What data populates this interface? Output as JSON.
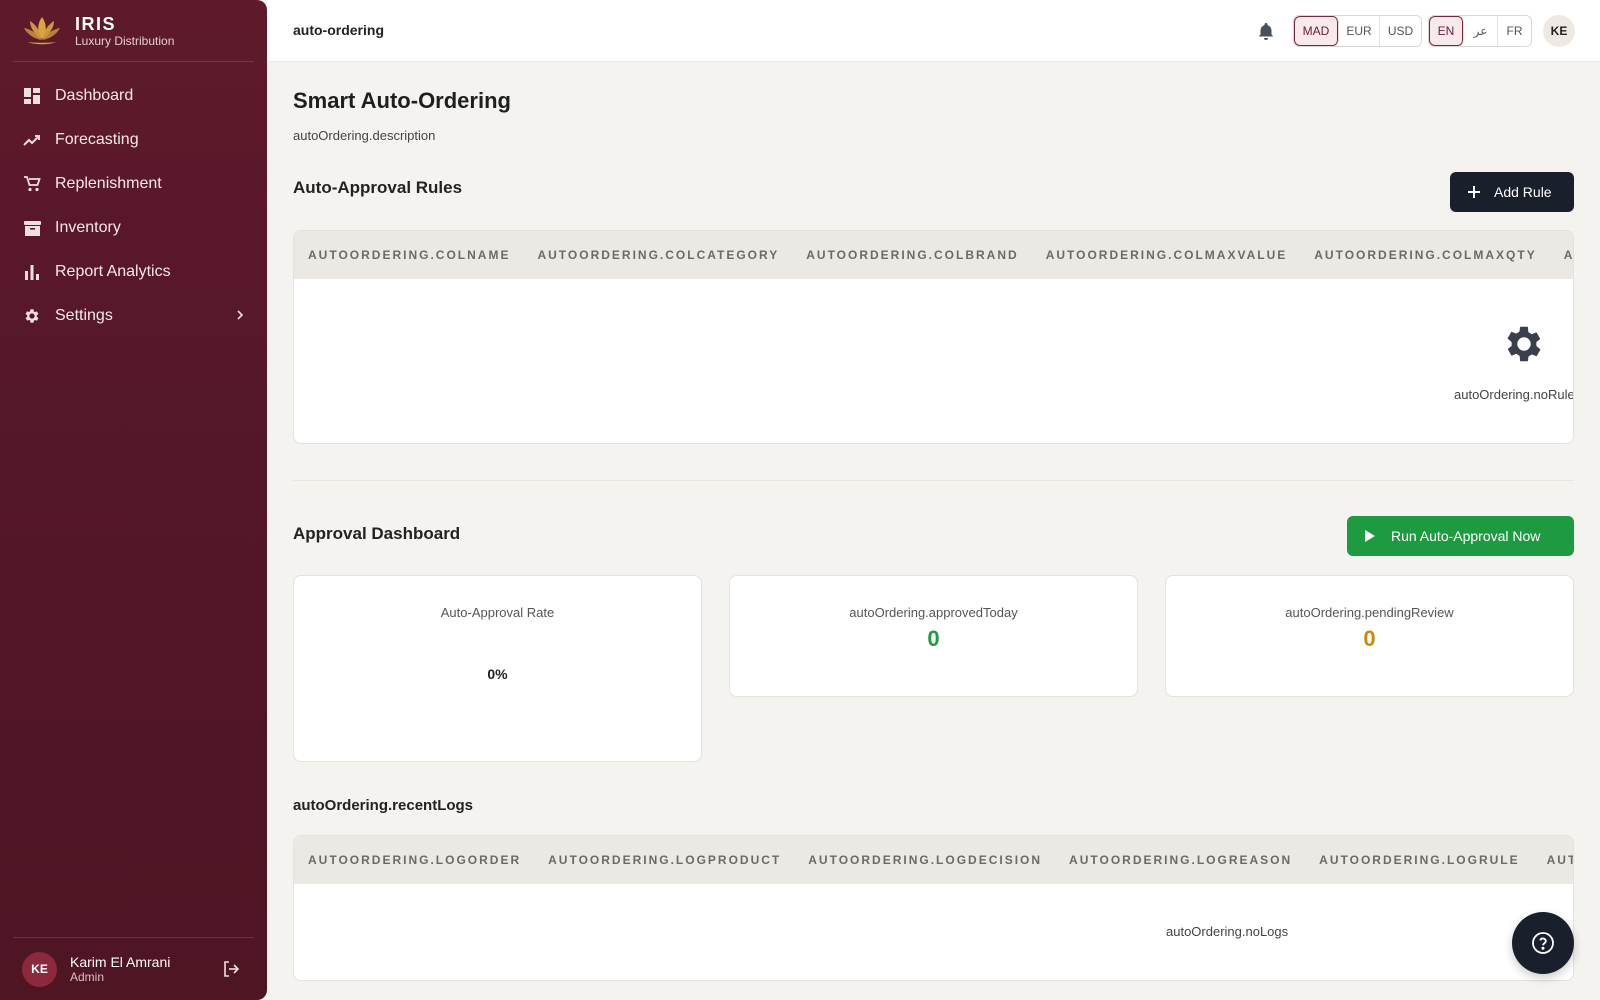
{
  "sidebar": {
    "brand_name": "IRIS",
    "brand_sub": "Luxury Distribution",
    "items": [
      {
        "label": "Dashboard",
        "icon": "dashboard-icon"
      },
      {
        "label": "Forecasting",
        "icon": "trending-up-icon"
      },
      {
        "label": "Replenishment",
        "icon": "cart-icon"
      },
      {
        "label": "Inventory",
        "icon": "archive-icon"
      },
      {
        "label": "Report Analytics",
        "icon": "bar-chart-icon"
      },
      {
        "label": "Settings",
        "icon": "gear-icon"
      }
    ],
    "user": {
      "initials": "KE",
      "name": "Karim El Amrani",
      "role": "Admin"
    }
  },
  "topbar": {
    "breadcrumb": "auto-ordering",
    "currencies": [
      "MAD",
      "EUR",
      "USD"
    ],
    "selected_currency": "MAD",
    "languages": [
      "EN",
      "عر",
      "FR"
    ],
    "selected_language": "EN",
    "avatar_initials": "KE"
  },
  "page": {
    "title": "Smart Auto-Ordering",
    "description": "autoOrdering.description"
  },
  "rules": {
    "title": "Auto-Approval Rules",
    "add_button": "Add Rule",
    "columns": [
      "AUTOORDERING.COLNAME",
      "AUTOORDERING.COLCATEGORY",
      "AUTOORDERING.COLBRAND",
      "AUTOORDERING.COLMAXVALUE",
      "AUTOORDERING.COLMAXQTY",
      "AUTOORDERING.COLSTATUS"
    ],
    "empty_text": "autoOrdering.noRules"
  },
  "dashboard": {
    "title": "Approval Dashboard",
    "run_button": "Run Auto-Approval Now",
    "stats": [
      {
        "label": "Auto-Approval Rate",
        "value": "0%"
      },
      {
        "label": "autoOrdering.approvedToday",
        "value": "0",
        "color": "#1e9b41"
      },
      {
        "label": "autoOrdering.pendingReview",
        "value": "0",
        "color": "#c98a0a"
      }
    ]
  },
  "logs": {
    "title": "autoOrdering.recentLogs",
    "columns": [
      "AUTOORDERING.LOGORDER",
      "AUTOORDERING.LOGPRODUCT",
      "AUTOORDERING.LOGDECISION",
      "AUTOORDERING.LOGREASON",
      "AUTOORDERING.LOGRULE",
      "AUTOORDERING.LOGDATE"
    ],
    "empty_text": "autoOrdering.noLogs"
  },
  "colors": {
    "sidebar": "#5a1727",
    "primary_dark": "#1a1f2c",
    "success": "#1e9b41",
    "warning": "#c98a0a"
  }
}
